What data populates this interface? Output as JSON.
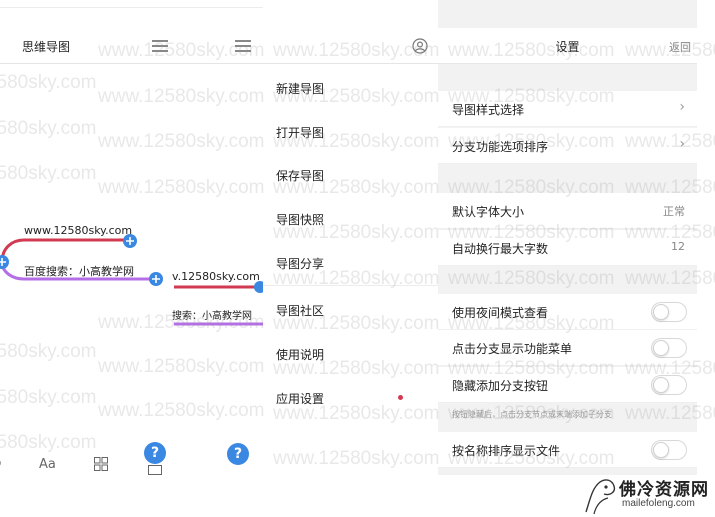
{
  "panel1": {
    "title": "思维导图",
    "node_website": "www.12580sky.com",
    "node_search": "百度搜索：小高教学网",
    "toolbar": {
      "font_label": "Aa",
      "help_label": "?"
    }
  },
  "panel2": {
    "node_website": "v.12580sky.com",
    "node_search": "搜索：小高教学网",
    "menu": [
      {
        "label": "新建导图"
      },
      {
        "label": "打开导图"
      },
      {
        "label": "保存导图"
      },
      {
        "label": "导图快照"
      },
      {
        "label": "导图分享"
      },
      {
        "label": "导图社区"
      },
      {
        "label": "使用说明"
      },
      {
        "label": "应用设置"
      }
    ],
    "help_label": "?"
  },
  "panel3": {
    "title": "设置",
    "back_label": "返回",
    "rows": {
      "style": {
        "label": "导图样式选择"
      },
      "branch_sort": {
        "label": "分支功能选项排序"
      },
      "font_size": {
        "label": "默认字体大小",
        "value": "正常"
      },
      "wrap_chars": {
        "label": "自动换行最大字数",
        "value": "12"
      },
      "night_mode": {
        "label": "使用夜间模式查看",
        "on": false
      },
      "branch_menu": {
        "label": "点击分支显示功能菜单",
        "on": false
      },
      "hide_add": {
        "label": "隐藏添加分支按钮",
        "on": false
      },
      "sort_name": {
        "label": "按名称排序显示文件",
        "on": false
      }
    },
    "hint": "按钮隐藏后，点击分支节点或末端添加子分支"
  },
  "watermark_text": "www.12580sky.com",
  "logo": {
    "cn": "佛冷资源网",
    "en": "mailefoleng.com"
  },
  "colors": {
    "branch_red": "#d23a52",
    "branch_purple": "#b46ee6",
    "accent_blue": "#3b88e3"
  }
}
